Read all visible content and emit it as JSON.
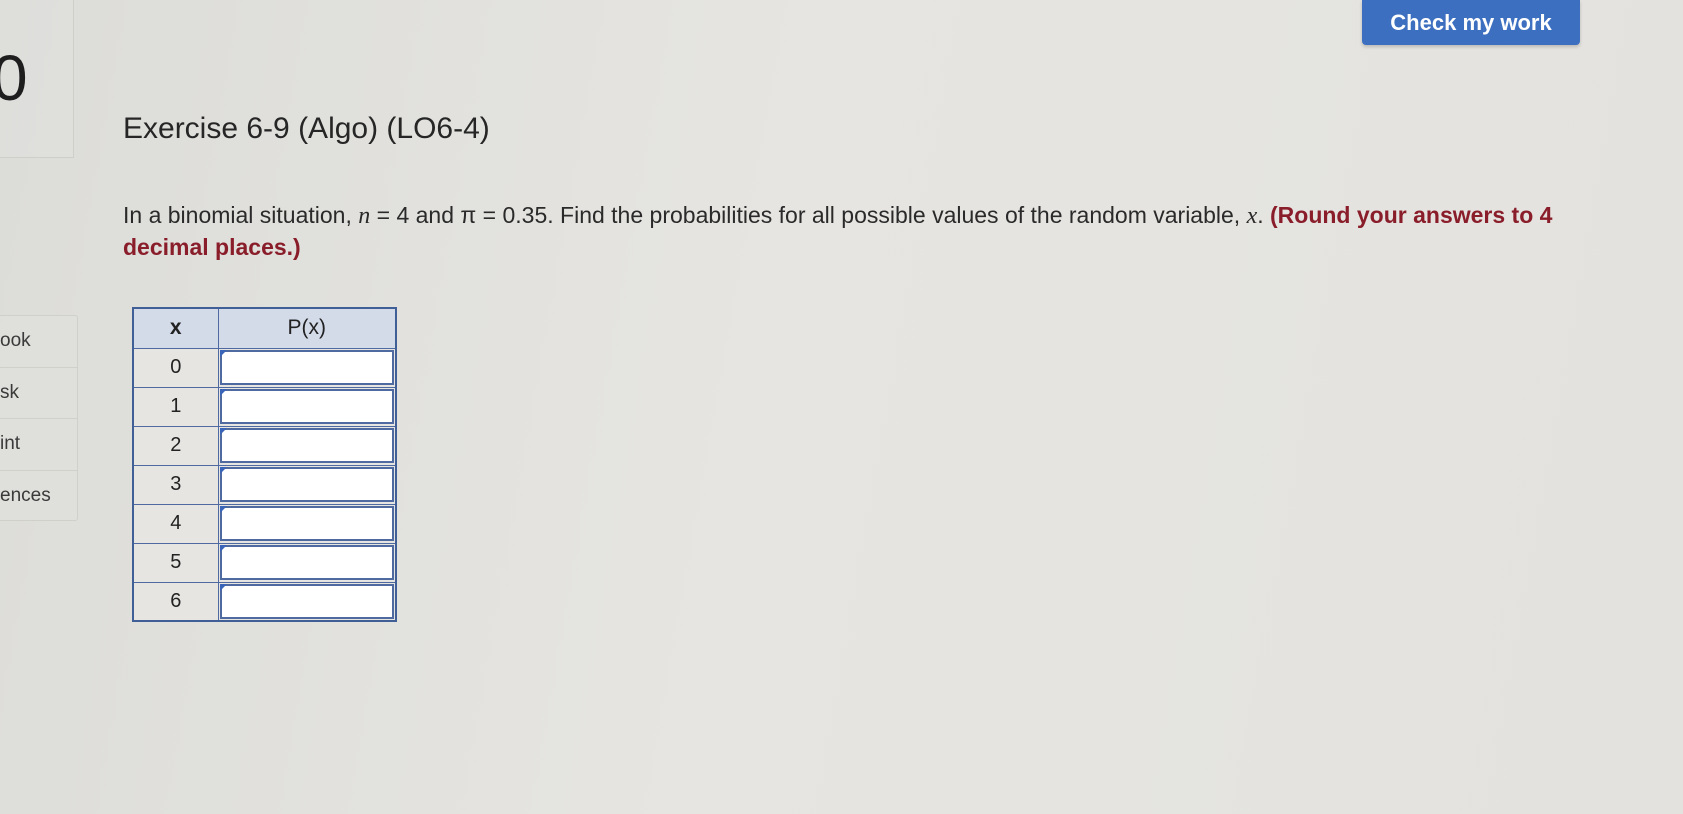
{
  "toolbar": {
    "check_label": "Check my work"
  },
  "question_number": "0",
  "sidebar": {
    "items": [
      {
        "label": "ook"
      },
      {
        "label": "sk"
      },
      {
        "label": "int"
      },
      {
        "label": "ences"
      }
    ]
  },
  "exercise": {
    "title": "Exercise 6-9 (Algo) (LO6-4)",
    "text_before_n": "In a binomial situation, ",
    "n_symbol": "n",
    "n_equals": " = 4 and π = 0.35. Find the probabilities for all possible values of the random variable, ",
    "x_symbol": "x",
    "text_end": ". ",
    "instruction": "(Round your answers to 4 decimal places.)"
  },
  "table": {
    "headers": {
      "x": "x",
      "px": "P(x)"
    },
    "rows": [
      {
        "x": "0",
        "value": ""
      },
      {
        "x": "1",
        "value": ""
      },
      {
        "x": "2",
        "value": ""
      },
      {
        "x": "3",
        "value": ""
      },
      {
        "x": "4",
        "value": ""
      },
      {
        "x": "5",
        "value": ""
      },
      {
        "x": "6",
        "value": ""
      }
    ]
  },
  "colors": {
    "button": "#3c6fbf",
    "header_bg": "#d3dbe9",
    "border": "#4f6aa0",
    "instruction": "#8a1d2a"
  }
}
